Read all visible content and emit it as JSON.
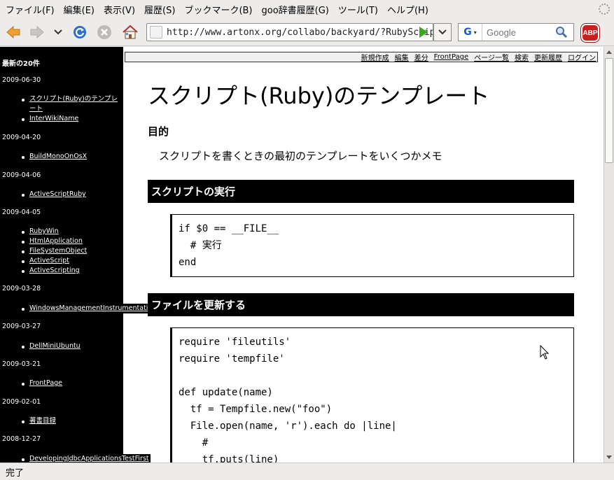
{
  "menubar": {
    "items": [
      "ファイル(F)",
      "編集(E)",
      "表示(V)",
      "履歴(S)",
      "ブックマーク(B)",
      "goo辞書履歴(G)",
      "ツール(T)",
      "ヘルプ(H)"
    ]
  },
  "navbar": {
    "url": "http://www.artonx.org/collabo/backyard/?RubyScriptTe",
    "search_engine": "G",
    "search_placeholder": "Google",
    "adblock_label": "ABP",
    "icons": [
      "back-arrow-icon",
      "forward-arrow-icon",
      "history-dropdown-icon",
      "reload-icon",
      "stop-icon",
      "home-icon",
      "go-arrow-icon",
      "search-magnifier-icon"
    ]
  },
  "sidebar": {
    "title": "最新の20件",
    "groups": [
      {
        "date": "2009-06-30",
        "links": [
          "スクリプト(Ruby)のテンプレート",
          "InterWikiName"
        ]
      },
      {
        "date": "2009-04-20",
        "links": [
          "BuildMonoOnOsX"
        ]
      },
      {
        "date": "2009-04-06",
        "links": [
          "ActiveScriptRuby"
        ]
      },
      {
        "date": "2009-04-05",
        "links": [
          "RubyWin",
          "HtmlApplication",
          "FileSystemObject",
          "ActiveScript",
          "ActiveScripting"
        ]
      },
      {
        "date": "2009-03-28",
        "links": [
          "WindowsManagementInstrumentation"
        ]
      },
      {
        "date": "2009-03-27",
        "links": [
          "DellMiniUbuntu"
        ]
      },
      {
        "date": "2009-03-21",
        "links": [
          "FrontPage"
        ]
      },
      {
        "date": "2009-02-01",
        "links": [
          "著書目録"
        ]
      },
      {
        "date": "2008-12-27",
        "links": [
          "DevelopingJdbcApplicationsTestFirst"
        ]
      }
    ]
  },
  "topnav": {
    "links": [
      "新規作成",
      "編集",
      "差分",
      "FrontPage",
      "ページ一覧",
      "検索",
      "更新履歴",
      "ログイン"
    ]
  },
  "page": {
    "title": "スクリプト(Ruby)のテンプレート",
    "purpose_heading": "目的",
    "purpose_text": "スクリプトを書くときの最初のテンプレートをいくつかメモ",
    "section1_heading": "スクリプトの実行",
    "code1": [
      "if $0 == __FILE__",
      "  # 実行",
      "end"
    ],
    "section2_heading": "ファイルを更新する",
    "code2": [
      "require 'fileutils'",
      "require 'tempfile'",
      "",
      "def update(name)",
      "  tf = Tempfile.new(\"foo\")",
      "  File.open(name, 'r').each do |line|",
      "    #",
      "    tf.puts(line)"
    ]
  },
  "statusbar": {
    "text": "完了"
  },
  "colors": {
    "chrome": "#edeceb",
    "sidebar_bg": "#000000",
    "heading_bar": "#000000",
    "reload_blue": "#2b6fd1",
    "back_orange": "#f0a030",
    "go_green": "#3aa81e",
    "abp_red": "#c91f1f"
  }
}
